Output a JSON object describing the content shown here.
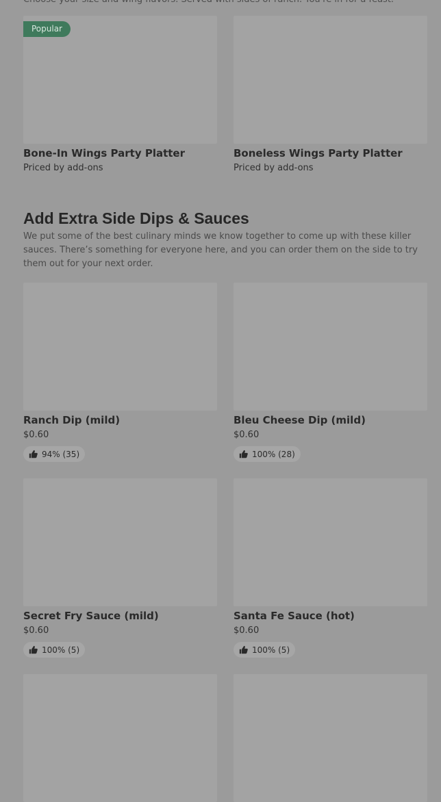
{
  "platters": {
    "cut_text": "Choose your size and wing flavors. Served with sides of ranch. You're in for a feast.",
    "items": [
      {
        "badge": "Popular",
        "name": "Bone-In Wings Party Platter",
        "price": "Priced by add-ons"
      },
      {
        "name": "Boneless Wings Party Platter",
        "price": "Priced by add-ons"
      }
    ]
  },
  "dips": {
    "title": "Add Extra Side Dips & Sauces",
    "description": "We put some of the best culinary minds we know together to come up with these killer sauces. There’s something for everyone here, and you can order them on the side to try them out for your next order.",
    "items": [
      {
        "name": "Ranch Dip (mild)",
        "price": "$0.60",
        "rating": "94% (35)"
      },
      {
        "name": "Bleu Cheese Dip (mild)",
        "price": "$0.60",
        "rating": "100% (28)"
      },
      {
        "name": "Secret Fry Sauce (mild)",
        "price": "$0.60",
        "rating": "100% (5)"
      },
      {
        "name": "Santa Fe Sauce (hot)",
        "price": "$0.60",
        "rating": "100% (5)"
      }
    ]
  },
  "icons": {
    "rating": "thumbs-up-icon"
  }
}
